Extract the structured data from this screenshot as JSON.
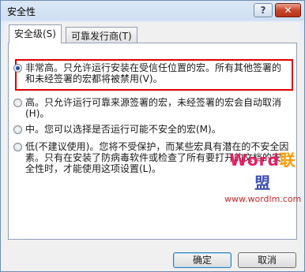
{
  "window": {
    "title": "安全性",
    "help_label": "?",
    "close_label": "✕"
  },
  "tabs": [
    {
      "label": "安全级(S)",
      "active": true
    },
    {
      "label": "可靠发行商(T)",
      "active": false
    }
  ],
  "options": [
    {
      "text": "非常高。只允许运行安装在受信任位置的宏。所有其他签署的和未经签署的宏都将被禁用(V)。",
      "checked": true
    },
    {
      "text": "高。只允许运行可靠来源签署的宏，未经签署的宏会自动取消(H)。",
      "checked": false
    },
    {
      "text": "中。您可以选择是否运行可能不安全的宏(M)。",
      "checked": false
    },
    {
      "text": "低(不建议使用)。您将不受保护，而某些宏具有潜在的不安全因素。只有在安装了防病毒软件或检查了所有要打开的文档的安全性时，才能使用这项设置(L)。",
      "checked": false
    }
  ],
  "watermark": {
    "logo_parts": [
      "Word",
      "联",
      "盟"
    ],
    "url": "www.wordlm.com"
  },
  "buttons": {
    "ok": "确定",
    "cancel": "取消"
  },
  "colors": {
    "highlight_border": "#e00000",
    "radio_dot": "#1d4e9c"
  }
}
